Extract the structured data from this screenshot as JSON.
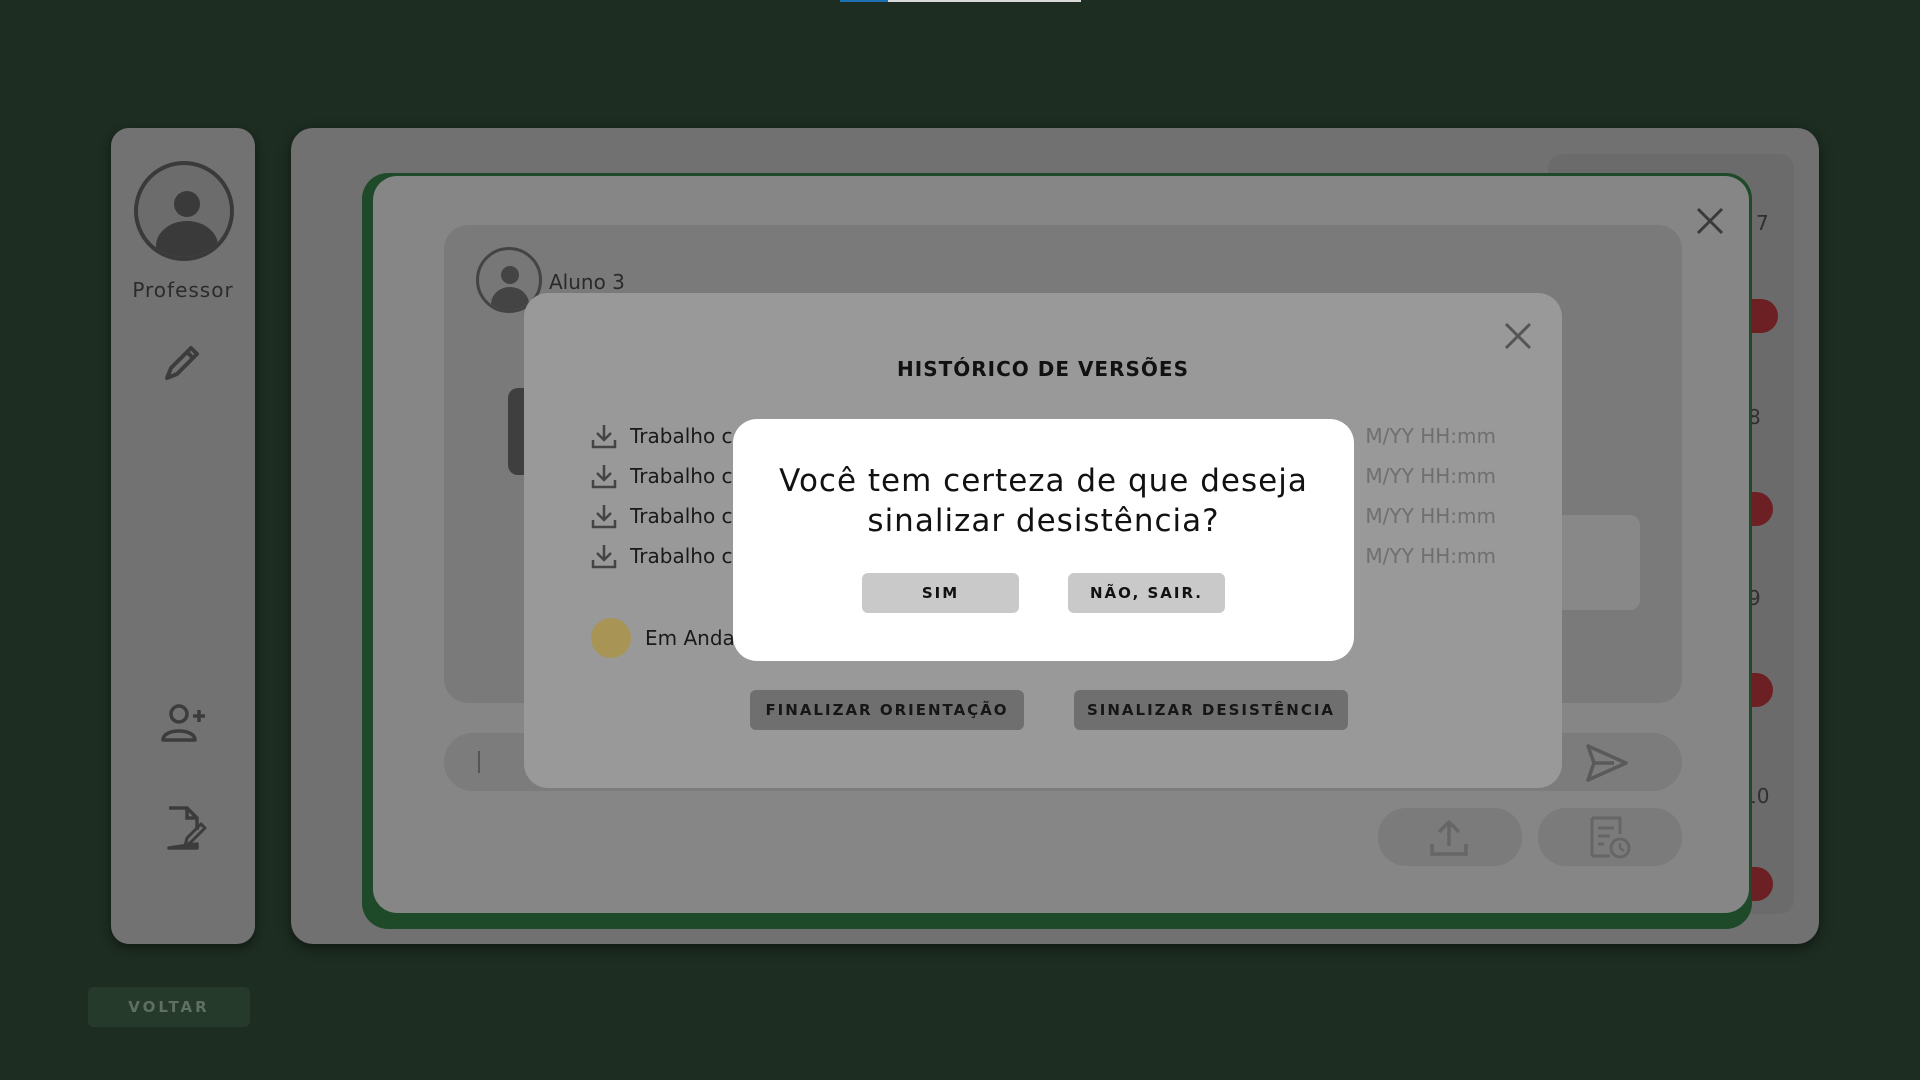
{
  "sidebar": {
    "user_label": "Professor",
    "icons": [
      "user-avatar-icon",
      "pencil-icon",
      "add-user-icon",
      "edit-document-icon"
    ]
  },
  "footer": {
    "back_label": "VOLTAR"
  },
  "list": {
    "numbers": [
      "7",
      "8",
      "9",
      "10"
    ],
    "pill_color": "#6d2024"
  },
  "chat": {
    "student_name": "Aluno 3",
    "icons": [
      "close-icon",
      "send-icon",
      "upload-icon",
      "version-history-icon"
    ]
  },
  "history": {
    "title": "HISTÓRICO DE VERSÕES",
    "versions": [
      {
        "name": "Trabalho c",
        "date": "M/YY HH:mm"
      },
      {
        "name": "Trabalho c",
        "date": "M/YY HH:mm"
      },
      {
        "name": "Trabalho c",
        "date": "M/YY HH:mm"
      },
      {
        "name": "Trabalho c",
        "date": "M/YY HH:mm"
      }
    ],
    "status": {
      "label": "Em Anda",
      "color": "#c9b56a"
    },
    "finalize_label": "FINALIZAR ORIENTAÇÃO",
    "withdraw_label": "SINALIZAR DESISTÊNCIA"
  },
  "confirm": {
    "question_line1": "Você tem certeza de que deseja",
    "question_line2": "sinalizar desistência?",
    "yes_label": "SIM",
    "no_label": "NÃO, SAIR."
  },
  "colors": {
    "background": "#1d2d21",
    "modal_border": "#1e4a29",
    "accent_blue": "#1c6fb0"
  }
}
